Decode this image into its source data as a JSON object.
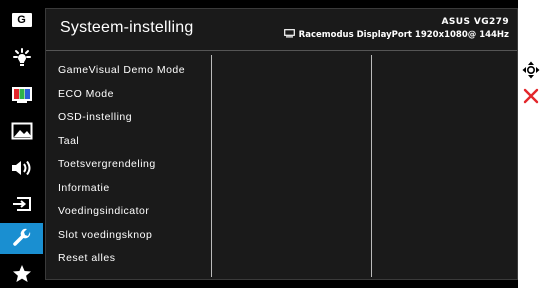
{
  "header": {
    "title": "Systeem-instelling",
    "model": "ASUS VG279",
    "mode": "Racemodus DisplayPort 1920x1080@ 144Hz"
  },
  "sidebar": {
    "items": [
      {
        "icon": "gamevisual-icon",
        "label": "G"
      },
      {
        "icon": "brightness-icon"
      },
      {
        "icon": "color-bars-icon"
      },
      {
        "icon": "image-icon"
      },
      {
        "icon": "sound-icon"
      },
      {
        "icon": "input-select-icon"
      },
      {
        "icon": "wrench-icon",
        "active": true
      },
      {
        "icon": "star-icon"
      }
    ]
  },
  "menu": {
    "items": [
      "GameVisual Demo Mode",
      "ECO Mode",
      "OSD-instelling",
      "Taal",
      "Toetsvergrendeling",
      "Informatie",
      "Voedingsindicator",
      "Slot voedingsknop",
      "Reset alles"
    ]
  },
  "controls": {
    "navigate_icon": "five-way-joystick-icon",
    "close_icon": "close-icon"
  },
  "colors": {
    "background": "#000000",
    "panel": "#1a1a1a",
    "accent": "#1a8fd1",
    "close_red": "#e3262b"
  }
}
